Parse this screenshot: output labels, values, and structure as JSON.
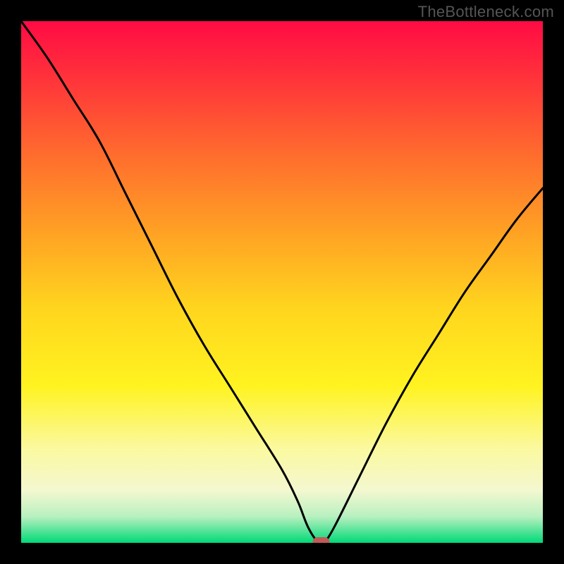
{
  "watermark": "TheBottleneck.com",
  "chart_data": {
    "type": "line",
    "title": "",
    "xlabel": "",
    "ylabel": "",
    "xlim": [
      0,
      100
    ],
    "ylim": [
      0,
      100
    ],
    "x": [
      0,
      5,
      10,
      15,
      20,
      25,
      30,
      35,
      40,
      45,
      50,
      53,
      55,
      57,
      58,
      60,
      65,
      70,
      75,
      80,
      85,
      90,
      95,
      100
    ],
    "values": [
      100,
      93,
      85,
      77,
      67,
      57,
      47,
      38,
      30,
      22,
      14,
      8,
      3,
      0,
      0,
      3,
      13,
      23,
      32,
      40,
      48,
      55,
      62,
      68
    ],
    "minimum_marker": {
      "x": 57.5,
      "y": 0
    },
    "background_gradient": {
      "stops": [
        {
          "pos": 0.0,
          "color": "#ff0b44"
        },
        {
          "pos": 0.1,
          "color": "#ff2f3b"
        },
        {
          "pos": 0.25,
          "color": "#ff6a2e"
        },
        {
          "pos": 0.4,
          "color": "#ffa024"
        },
        {
          "pos": 0.55,
          "color": "#ffd51e"
        },
        {
          "pos": 0.7,
          "color": "#fff320"
        },
        {
          "pos": 0.82,
          "color": "#fbf9a0"
        },
        {
          "pos": 0.9,
          "color": "#f3f8d0"
        },
        {
          "pos": 0.95,
          "color": "#b8f0c0"
        },
        {
          "pos": 1.0,
          "color": "#00d977"
        }
      ]
    }
  }
}
